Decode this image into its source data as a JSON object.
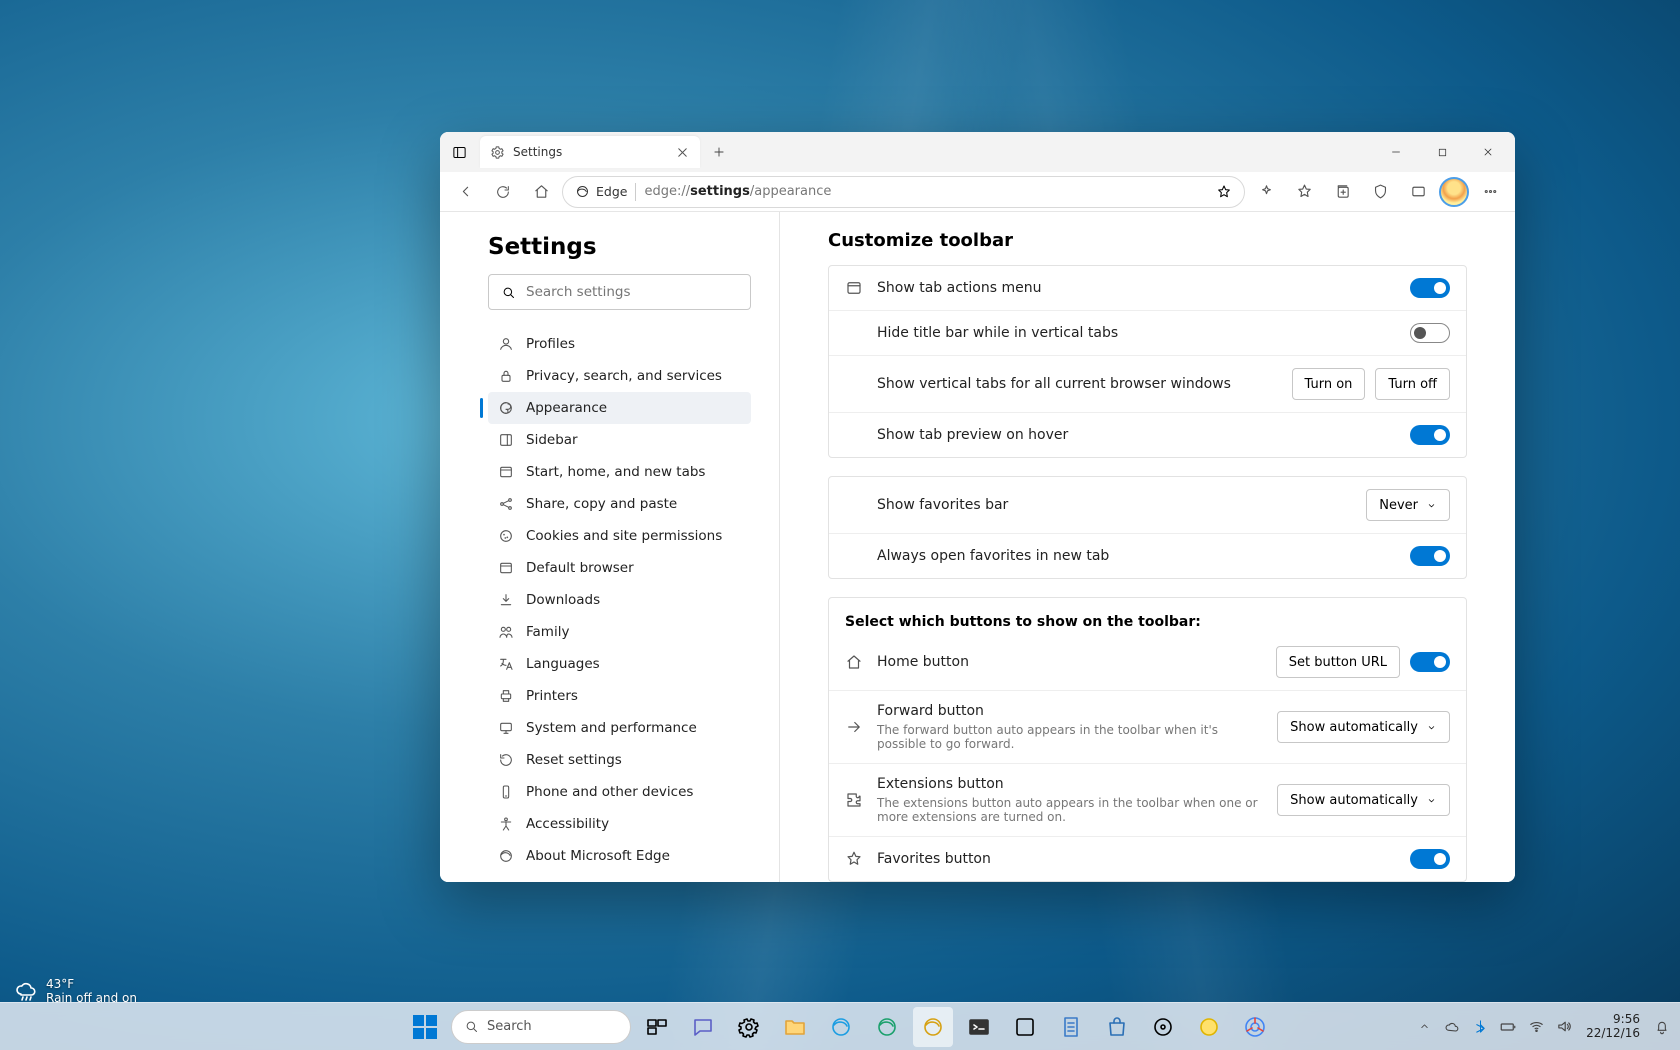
{
  "window": {
    "tab_title": "Settings",
    "url_prefix": "edge://",
    "url_bold": "settings",
    "url_suffix": "/appearance",
    "product": "Edge"
  },
  "sidebar": {
    "title": "Settings",
    "search_placeholder": "Search settings",
    "items": [
      {
        "label": "Profiles"
      },
      {
        "label": "Privacy, search, and services"
      },
      {
        "label": "Appearance"
      },
      {
        "label": "Sidebar"
      },
      {
        "label": "Start, home, and new tabs"
      },
      {
        "label": "Share, copy and paste"
      },
      {
        "label": "Cookies and site permissions"
      },
      {
        "label": "Default browser"
      },
      {
        "label": "Downloads"
      },
      {
        "label": "Family"
      },
      {
        "label": "Languages"
      },
      {
        "label": "Printers"
      },
      {
        "label": "System and performance"
      },
      {
        "label": "Reset settings"
      },
      {
        "label": "Phone and other devices"
      },
      {
        "label": "Accessibility"
      },
      {
        "label": "About Microsoft Edge"
      }
    ]
  },
  "main": {
    "title": "Customize toolbar",
    "rows": {
      "tab_actions": "Show tab actions menu",
      "hide_title_bar": "Hide title bar while in vertical tabs",
      "vertical_tabs_all": "Show vertical tabs for all current browser windows",
      "turn_on": "Turn on",
      "turn_off": "Turn off",
      "tab_preview": "Show tab preview on hover",
      "show_favorites_bar": "Show favorites bar",
      "favorites_bar_value": "Never",
      "fav_new_tab": "Always open favorites in new tab",
      "buttons_heading": "Select which buttons to show on the toolbar:",
      "home_button": "Home button",
      "set_url": "Set button URL",
      "forward_button": "Forward button",
      "forward_sub": "The forward button auto appears in the toolbar when it's possible to go forward.",
      "show_auto": "Show automatically",
      "extensions_button": "Extensions button",
      "extensions_sub": "The extensions button auto appears in the toolbar when one or more extensions are turned on.",
      "favorites_button": "Favorites button"
    }
  },
  "weather": {
    "temp": "43°F",
    "desc": "Rain off and on"
  },
  "taskbar": {
    "search": "Search"
  },
  "systray": {
    "time": "9:56",
    "date": "22/12/16"
  }
}
